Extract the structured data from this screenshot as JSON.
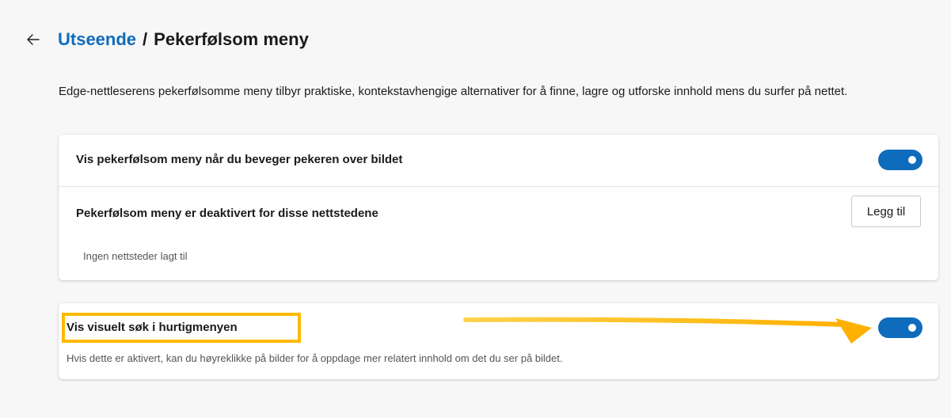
{
  "header": {
    "back_icon": "arrow-left-icon",
    "breadcrumb_link": "Utseende",
    "separator": "/",
    "current": "Pekerfølsom meny"
  },
  "description": "Edge-nettleserens pekerfølsomme meny tilbyr praktiske, kontekstavhengige alternativer for å finne, lagre og utforske innhold mens du surfer på nettet.",
  "hover_menu_card": {
    "toggle_label": "Vis pekerfølsom meny når du beveger pekeren over bildet",
    "toggle_on": true,
    "disabled_sites_label": "Pekerfølsom meny er deaktivert for disse nettstedene",
    "add_button": "Legg til",
    "empty_text": "Ingen nettsteder lagt til"
  },
  "visual_search_card": {
    "toggle_label": "Vis visuelt søk i hurtigmenyen",
    "toggle_on": true,
    "description": "Hvis dette er aktivert, kan du høyreklikke på bilder for å oppdage mer relatert innhold om det du ser på bildet."
  },
  "colors": {
    "accent": "#0f6cbd",
    "annotation": "#ffb900"
  }
}
